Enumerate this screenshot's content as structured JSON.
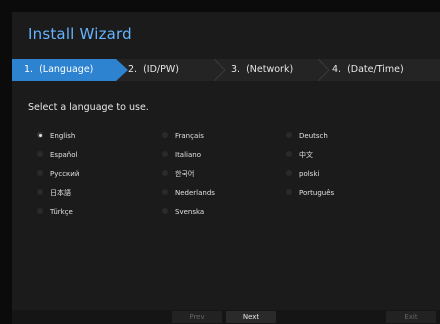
{
  "window": {
    "title": "Install Wizard"
  },
  "steps": [
    {
      "num": "1.",
      "label": "(Language)"
    },
    {
      "num": "2.",
      "label": "(ID/PW)"
    },
    {
      "num": "3.",
      "label": "(Network)"
    },
    {
      "num": "4.",
      "label": "(Date/Time)"
    }
  ],
  "prompt": "Select a language to use.",
  "languages": [
    {
      "label": "English",
      "selected": true
    },
    {
      "label": "Français",
      "selected": false
    },
    {
      "label": "Deutsch",
      "selected": false
    },
    {
      "label": "Español",
      "selected": false
    },
    {
      "label": "Italiano",
      "selected": false
    },
    {
      "label": "中文",
      "selected": false
    },
    {
      "label": "Русский",
      "selected": false
    },
    {
      "label": "한국어",
      "selected": false
    },
    {
      "label": "polski",
      "selected": false
    },
    {
      "label": "日本語",
      "selected": false
    },
    {
      "label": "Nederlands",
      "selected": false
    },
    {
      "label": "Português",
      "selected": false
    },
    {
      "label": "Türkçe",
      "selected": false
    },
    {
      "label": "Svenska",
      "selected": false
    }
  ],
  "buttons": {
    "prev": "Prev",
    "next": "Next",
    "exit": "Exit"
  },
  "colors": {
    "accent": "#2d83cf",
    "title": "#66b3ff"
  }
}
